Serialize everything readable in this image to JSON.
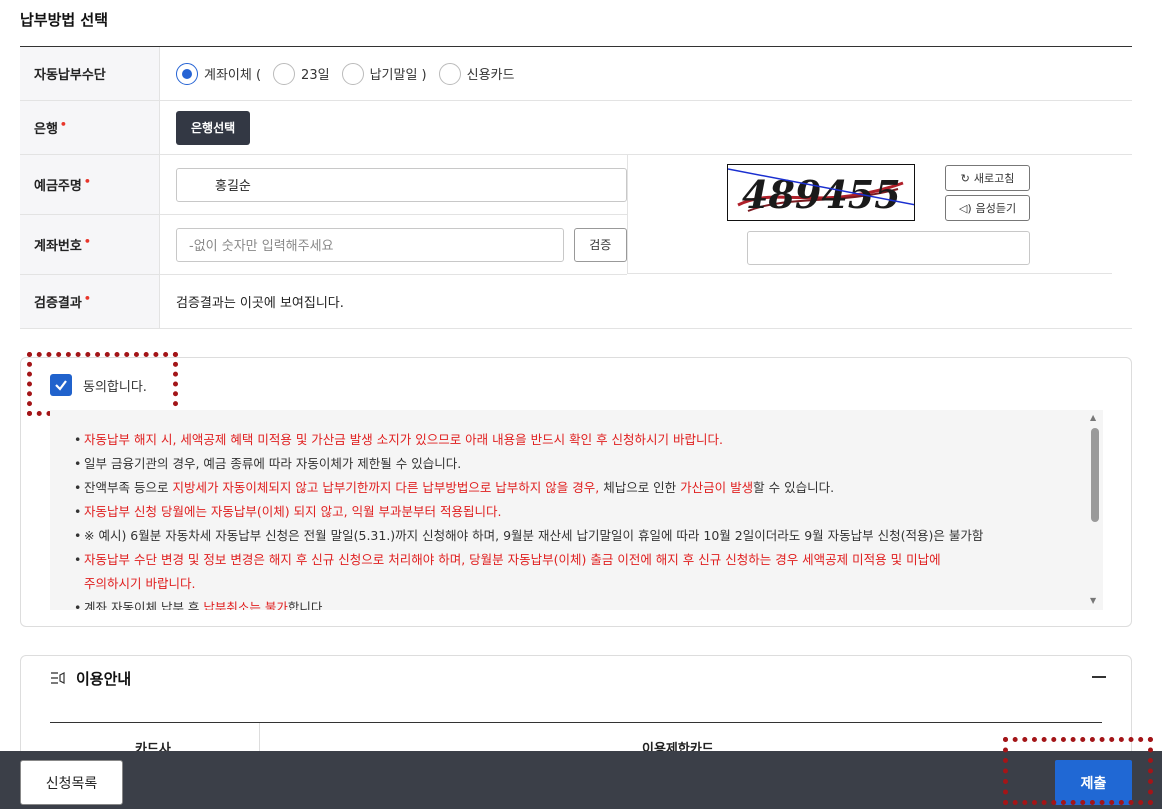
{
  "section_title": "납부방법 선택",
  "form": {
    "method_label": "자동납부수단",
    "method_options": [
      {
        "label": "계좌이체 (",
        "selected": true
      },
      {
        "label": "23일",
        "selected": false
      },
      {
        "label": "납기말일 )",
        "selected": false
      },
      {
        "label": "신용카드",
        "selected": false
      }
    ],
    "bank_label": "은행",
    "bank_button": "은행선택",
    "holder_label": "예금주명",
    "holder_value": "홍길순",
    "account_label": "계좌번호",
    "account_placeholder": "-없이 숫자만 입력해주세요",
    "verify_button": "검증",
    "result_label": "검증결과",
    "result_text": "검증결과는 이곳에 보여집니다.",
    "required_mark": "•"
  },
  "captcha": {
    "code": "489455",
    "refresh_label": "새로고침",
    "audio_label": "음성듣기",
    "input_value": ""
  },
  "agreement": {
    "checked": true,
    "label": "동의합니다.",
    "notices": [
      {
        "parts": [
          {
            "t": "자동납부 해지 시, 세액공제 혜택 미적용 및 가산금 발생 소지가 있으므로 아래 내용을 반드시 확인 후 신청하시기 바랍니다.",
            "red": true
          }
        ]
      },
      {
        "parts": [
          {
            "t": "일부 금융기관의 경우, 예금 종류에 따라 자동이체가 제한될 수 있습니다.",
            "red": false
          }
        ]
      },
      {
        "parts": [
          {
            "t": "잔액부족 등으로 ",
            "red": false
          },
          {
            "t": "지방세가 자동이체되지 않고 납부기한까지 다른 납부방법으로 납부하지 않을 경우,",
            "red": true
          },
          {
            "t": " 체납으로 인한 ",
            "red": false
          },
          {
            "t": "가산금이 발생",
            "red": true
          },
          {
            "t": "할 수 있습니다.",
            "red": false
          }
        ]
      },
      {
        "parts": [
          {
            "t": "자동납부 신청 당월에는 자동납부(이체) 되지 않고, 익월 부과분부터 적용됩니다.",
            "red": true
          }
        ]
      },
      {
        "parts": [
          {
            "t": "※ 예시) 6월분 자동차세 자동납부 신청은 전월 말일(5.31.)까지 신청해야 하며, 9월분 재산세 납기말일이 휴일에 따라 10월 2일이더라도 9월 자동납부 신청(적용)은 불가함",
            "red": false
          }
        ]
      },
      {
        "parts": [
          {
            "t": "자동납부 수단 변경 및 정보 변경은 해지 후 신규 신청으로 처리해야 하며, 당월분 자동납부(이체) 출금 이전에 해지 후 신규 신청하는 경우 세액공제 미적용 및 미납에",
            "red": true
          }
        ]
      },
      {
        "parts": [
          {
            "t": "주의하시기 바랍니다.",
            "red": true
          }
        ],
        "continuation": true
      },
      {
        "parts": [
          {
            "t": "계좌 자동이체 납부 후 ",
            "red": false
          },
          {
            "t": "납부취소는 불가",
            "red": true
          },
          {
            "t": "합니다.",
            "red": false
          }
        ]
      }
    ]
  },
  "info": {
    "title": "이용안내",
    "col_card": "카드사",
    "col_limit": "이용제한카드"
  },
  "footer": {
    "list_button": "신청목록",
    "submit_button": "제출"
  },
  "colors": {
    "primary": "#2068d4",
    "dark_button": "#333844",
    "footer_bg": "#3b3f48",
    "warning_red": "#e02020",
    "highlight": "#a31518"
  }
}
